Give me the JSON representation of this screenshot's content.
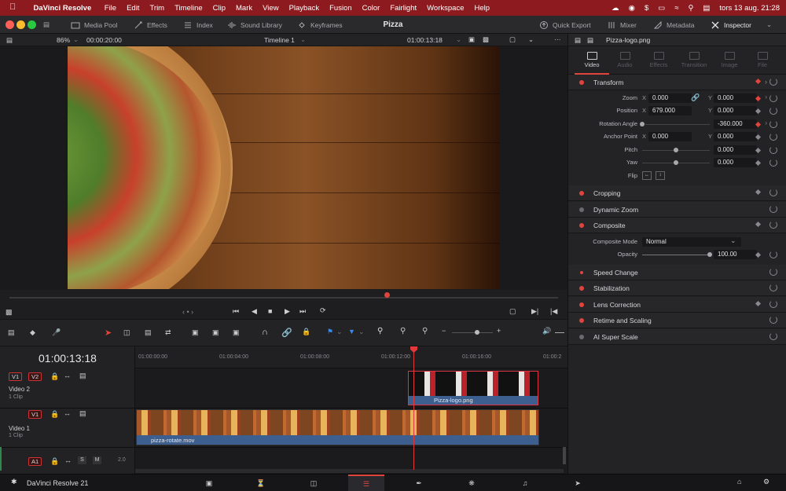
{
  "menubar": {
    "app": "DaVinci Resolve",
    "items": [
      "File",
      "Edit",
      "Trim",
      "Timeline",
      "Clip",
      "Mark",
      "View",
      "Playback",
      "Fusion",
      "Color",
      "Fairlight",
      "Workspace",
      "Help"
    ],
    "datetime": "tors 13 aug.  21:28"
  },
  "toolbar": {
    "media_pool": "Media Pool",
    "effects": "Effects",
    "index": "Index",
    "sound_library": "Sound Library",
    "keyframes": "Keyframes",
    "project_title": "Pizza",
    "quick_export": "Quick Export",
    "mixer": "Mixer",
    "metadata": "Metadata",
    "inspector": "Inspector"
  },
  "viewer": {
    "zoom": "86%",
    "duration": "00:00:20:00",
    "timeline_name": "Timeline 1",
    "timecode": "01:00:13:18"
  },
  "timeline": {
    "timecode": "01:00:13:18",
    "ruler": [
      "01:00:00:00",
      "01:00:04:00",
      "01:00:08:00",
      "01:00:12:00",
      "01:00:16:00",
      "01:00:2"
    ],
    "tracks": [
      {
        "id": "V1",
        "patch": "V2",
        "name": "Video 2",
        "clips": "1 Clip"
      },
      {
        "id": "V1",
        "name": "Video 1",
        "clips": "1 Clip"
      },
      {
        "id": "A1",
        "solo": "S",
        "mute": "M",
        "level": "2.0"
      }
    ],
    "clip_logo": "Pizza-logo.png",
    "clip_video": "pizza-rotate.mov"
  },
  "inspector": {
    "clip_name": "Pizza-logo.png",
    "tabs": [
      "Video",
      "Audio",
      "Effects",
      "Transition",
      "Image",
      "File"
    ],
    "transform": {
      "title": "Transform",
      "zoom_label": "Zoom",
      "zoom_x": "0.000",
      "zoom_y": "0.000",
      "position_label": "Position",
      "position_x": "679.000",
      "position_y": "0.000",
      "rotation_label": "Rotation Angle",
      "rotation": "-360.000",
      "anchor_label": "Anchor Point",
      "anchor_x": "0.000",
      "anchor_y": "0.000",
      "pitch_label": "Pitch",
      "pitch": "0.000",
      "yaw_label": "Yaw",
      "yaw": "0.000",
      "flip_label": "Flip",
      "x": "X",
      "y": "Y"
    },
    "cropping": "Cropping",
    "dynamic_zoom": "Dynamic Zoom",
    "composite": {
      "title": "Composite",
      "mode_label": "Composite Mode",
      "mode": "Normal",
      "opacity_label": "Opacity",
      "opacity": "100.00"
    },
    "speed_change": "Speed Change",
    "stabilization": "Stabilization",
    "lens_correction": "Lens Correction",
    "retime": "Retime and Scaling",
    "ai_super_scale": "AI Super Scale"
  },
  "bottombar": {
    "app_version": "DaVinci Resolve 21"
  },
  "colors": {
    "accent": "#e0443c",
    "clip_blue": "#3c5f8f",
    "menubar": "#8c1a1e"
  }
}
